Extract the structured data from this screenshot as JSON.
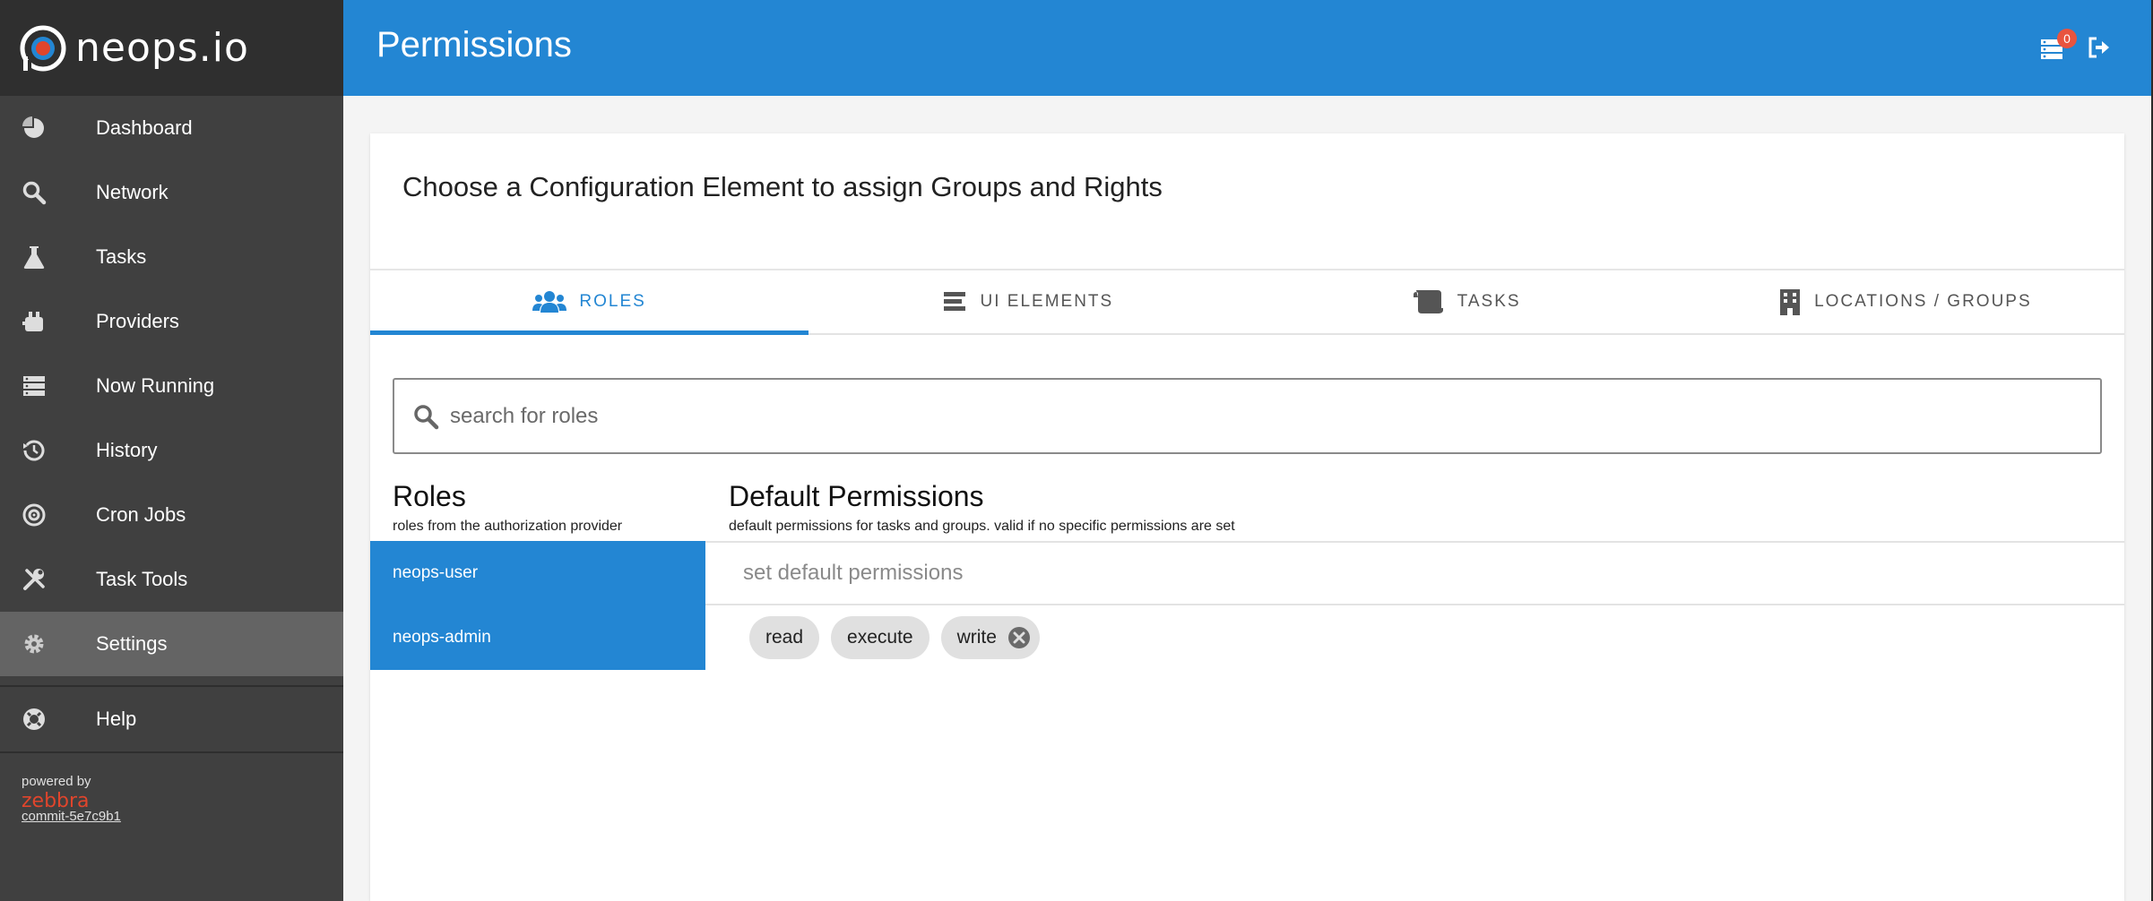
{
  "app": {
    "logo_text": "neops.io"
  },
  "sidebar": {
    "items": [
      {
        "label": "Dashboard",
        "icon": "pie-chart-icon"
      },
      {
        "label": "Network",
        "icon": "search-icon"
      },
      {
        "label": "Tasks",
        "icon": "flask-icon"
      },
      {
        "label": "Providers",
        "icon": "plug-icon"
      },
      {
        "label": "Now Running",
        "icon": "server-icon"
      },
      {
        "label": "History",
        "icon": "history-icon"
      },
      {
        "label": "Cron Jobs",
        "icon": "cron-icon"
      },
      {
        "label": "Task Tools",
        "icon": "tools-icon"
      },
      {
        "label": "Settings",
        "icon": "gear-icon",
        "active": true
      }
    ],
    "help_label": "Help",
    "powered_by": "powered by",
    "vendor": "zebbra",
    "commit": "commit-5e7c9b1"
  },
  "header": {
    "title": "Permissions",
    "notification_count": "0"
  },
  "card": {
    "title": "Choose a Configuration Element to assign Groups and Rights",
    "tabs": [
      {
        "label": "ROLES",
        "icon": "users-icon",
        "active": true
      },
      {
        "label": "UI ELEMENTS",
        "icon": "list-icon"
      },
      {
        "label": "TASKS",
        "icon": "scroll-icon"
      },
      {
        "label": "LOCATIONS / GROUPS",
        "icon": "building-icon"
      }
    ],
    "search_placeholder": "search for roles",
    "roles": {
      "title": "Roles",
      "subtitle": "roles from the authorization provider",
      "items": [
        "neops-user",
        "neops-admin"
      ]
    },
    "permissions": {
      "title": "Default Permissions",
      "subtitle": "default permissions for tasks and groups. valid if no specific permissions are set",
      "select_placeholder": "set default permissions",
      "chips": [
        "read",
        "execute",
        "write"
      ]
    }
  },
  "colors": {
    "accent": "#2386d3",
    "sidebar_bg": "#404040",
    "badge": "#e8543f",
    "vendor": "#e0452c"
  }
}
